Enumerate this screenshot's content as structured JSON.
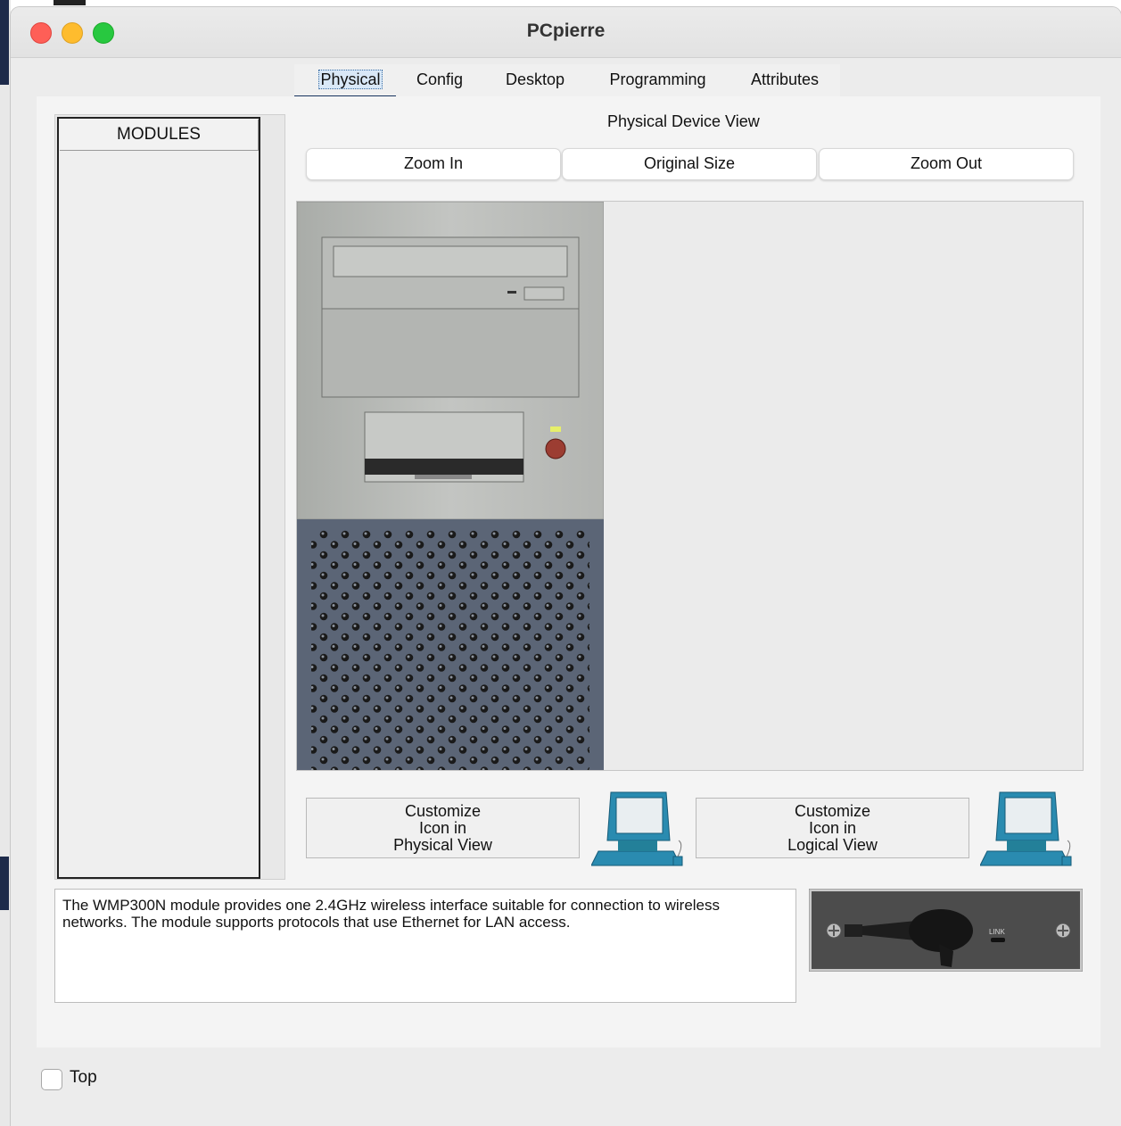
{
  "window": {
    "title": "PCpierre"
  },
  "tabs": [
    {
      "label": "Physical",
      "active": true
    },
    {
      "label": "Config"
    },
    {
      "label": "Desktop"
    },
    {
      "label": "Programming"
    },
    {
      "label": "Attributes"
    }
  ],
  "modules": {
    "header": "MODULES"
  },
  "physical": {
    "view_label": "Physical Device View",
    "zoom_in": "Zoom In",
    "original_size": "Original Size",
    "zoom_out": "Zoom Out",
    "customize_physical": [
      "Customize",
      "Icon in",
      "Physical View"
    ],
    "customize_logical": [
      "Customize",
      "Icon in",
      "Logical View"
    ]
  },
  "description": "The WMP300N module provides one 2.4GHz wireless interface suitable for connection to wireless networks. The module supports protocols that use Ethernet for LAN access.",
  "module_image": {
    "link_label": "LINK"
  },
  "footer": {
    "top_label": "Top",
    "top_checked": false
  },
  "colors": {
    "tab_underline": "#17335e",
    "pc_icon": "#2a8bb0"
  }
}
